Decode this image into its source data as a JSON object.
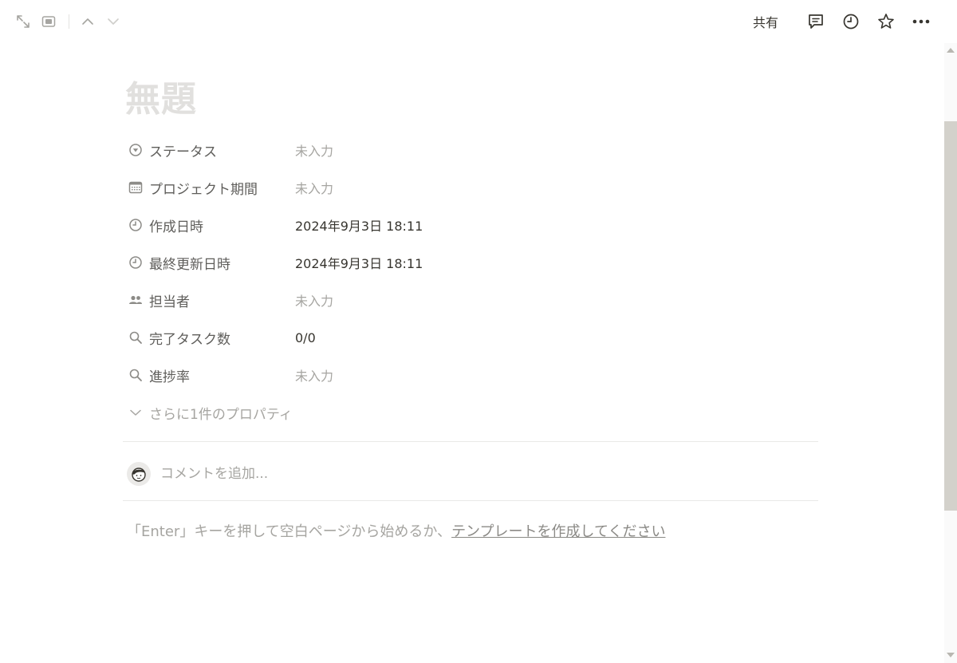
{
  "topbar": {
    "left_icons": [
      "expand-icon",
      "side-peek-icon",
      "chevron-up-icon",
      "chevron-down-icon"
    ],
    "share_label": "共有",
    "right_icons": [
      "comment-icon",
      "history-icon",
      "star-icon",
      "more-icon"
    ]
  },
  "page": {
    "title": "無題"
  },
  "properties": [
    {
      "icon": "status-icon",
      "name": "ステータス",
      "value": "未入力",
      "empty": true
    },
    {
      "icon": "calendar-icon",
      "name": "プロジェクト期間",
      "value": "未入力",
      "empty": true
    },
    {
      "icon": "clock-icon",
      "name": "作成日時",
      "value": "2024年9月3日 18:11",
      "empty": false
    },
    {
      "icon": "clock-icon",
      "name": "最終更新日時",
      "value": "2024年9月3日 18:11",
      "empty": false
    },
    {
      "icon": "people-icon",
      "name": "担当者",
      "value": "未入力",
      "empty": true
    },
    {
      "icon": "search-icon",
      "name": "完了タスク数",
      "value": "0/0",
      "empty": false
    },
    {
      "icon": "search-icon",
      "name": "進捗率",
      "value": "未入力",
      "empty": true
    }
  ],
  "more_properties": {
    "label": "さらに1件のプロパティ"
  },
  "comment": {
    "placeholder": "コメントを追加..."
  },
  "hint": {
    "text": "「Enter」キーを押して空白ページから始めるか、",
    "link": "テンプレートを作成してください"
  },
  "colors": {
    "text": "#37352f",
    "muted": "#a6a5a1",
    "title_placeholder": "#e1e0de",
    "divider": "#e9e9e7",
    "scroll_thumb": "#d3d1cb"
  }
}
